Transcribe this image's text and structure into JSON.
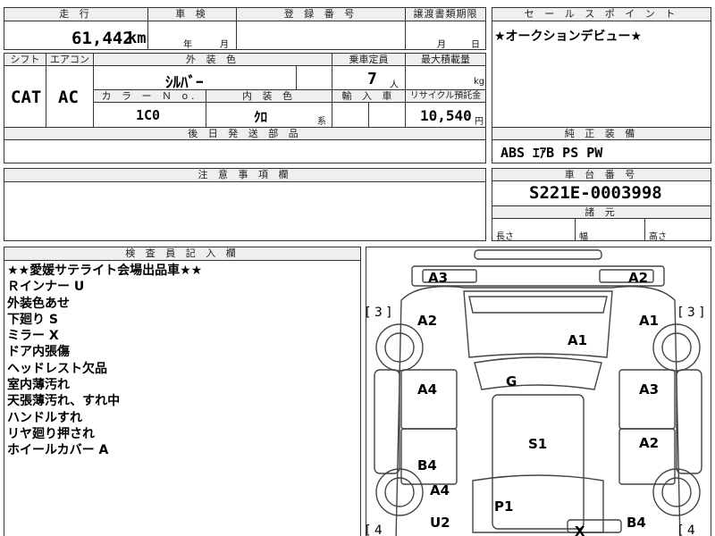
{
  "top": {
    "mileage_label": "走 行",
    "mileage_value": "61,442",
    "mileage_unit": "km",
    "inspection_label": "車 検",
    "inspection_year": "年",
    "inspection_month": "月",
    "reg_label": "登 録 番 号",
    "transfer_label": "譲渡書類期限",
    "transfer_month": "月",
    "transfer_day": "日"
  },
  "row2": {
    "shift_label": "シフト",
    "ac_label": "エアコン",
    "color_label": "外 装 色",
    "color_value": "ｼﾙﾊﾞｰ",
    "capacity_label": "乗車定員",
    "capacity_value": "7",
    "capacity_unit": "人",
    "load_label": "最大積載量",
    "load_unit": "kg",
    "shift_value": "CAT",
    "ac_value": "AC",
    "color_no_label": "カ ラ ー Ｎ o.",
    "interior_label": "内 装 色",
    "import_label": "輸 入 車",
    "recycle_label": "リサイクル預託金",
    "color_no_value": "1C0",
    "interior_value": "ｸﾛ",
    "interior_unit": "系",
    "recycle_value": "10,540",
    "recycle_unit": "円"
  },
  "delivery_label": "後 日 発 送 部 品",
  "sales": {
    "label": "セ ー ル ス ポ イ ン ト",
    "text": "★オークションデビュー★"
  },
  "equipment": {
    "label": "純 正 装 備",
    "value": "ABS ｴｱB PS PW"
  },
  "caution_label": "注 意 事 項 欄",
  "chassis": {
    "label": "車 台 番 号",
    "value": "S221E-0003998"
  },
  "specs": {
    "label": "諸 元",
    "length": "長さ",
    "width": "幅",
    "height": "高さ"
  },
  "inspector": {
    "label": "検 査 員 記 入 欄",
    "lines": [
      "★★愛媛サテライト会場出品車★★",
      "Ｒインナー U",
      "外装色あせ",
      "下廻り S",
      "ミラー X",
      "ドア内張傷",
      "ヘッドレスト欠品",
      "室内薄汚れ",
      "天張薄汚れ、すれ中",
      "ハンドルすれ",
      "リヤ廻り押され",
      "ホイールカバー A"
    ]
  },
  "diagram": {
    "marks": {
      "A3_left": "A3",
      "A2_top_right": "A2",
      "bracket_left": "[ 3 ]",
      "bracket_right": "[ 3 ]",
      "A2_left": "A2",
      "A1_right": "A1",
      "A1_hood": "A1",
      "G": "G",
      "A4_left": "A4",
      "A3_right": "A3",
      "S1": "S1",
      "A2_right": "A2",
      "B4_left": "B4",
      "A4_lower": "A4",
      "P1": "P1",
      "U2": "U2",
      "B4_right": "B4",
      "X": "X",
      "bracket_bl": "[ 4",
      "bracket_br": "[ 4"
    }
  }
}
